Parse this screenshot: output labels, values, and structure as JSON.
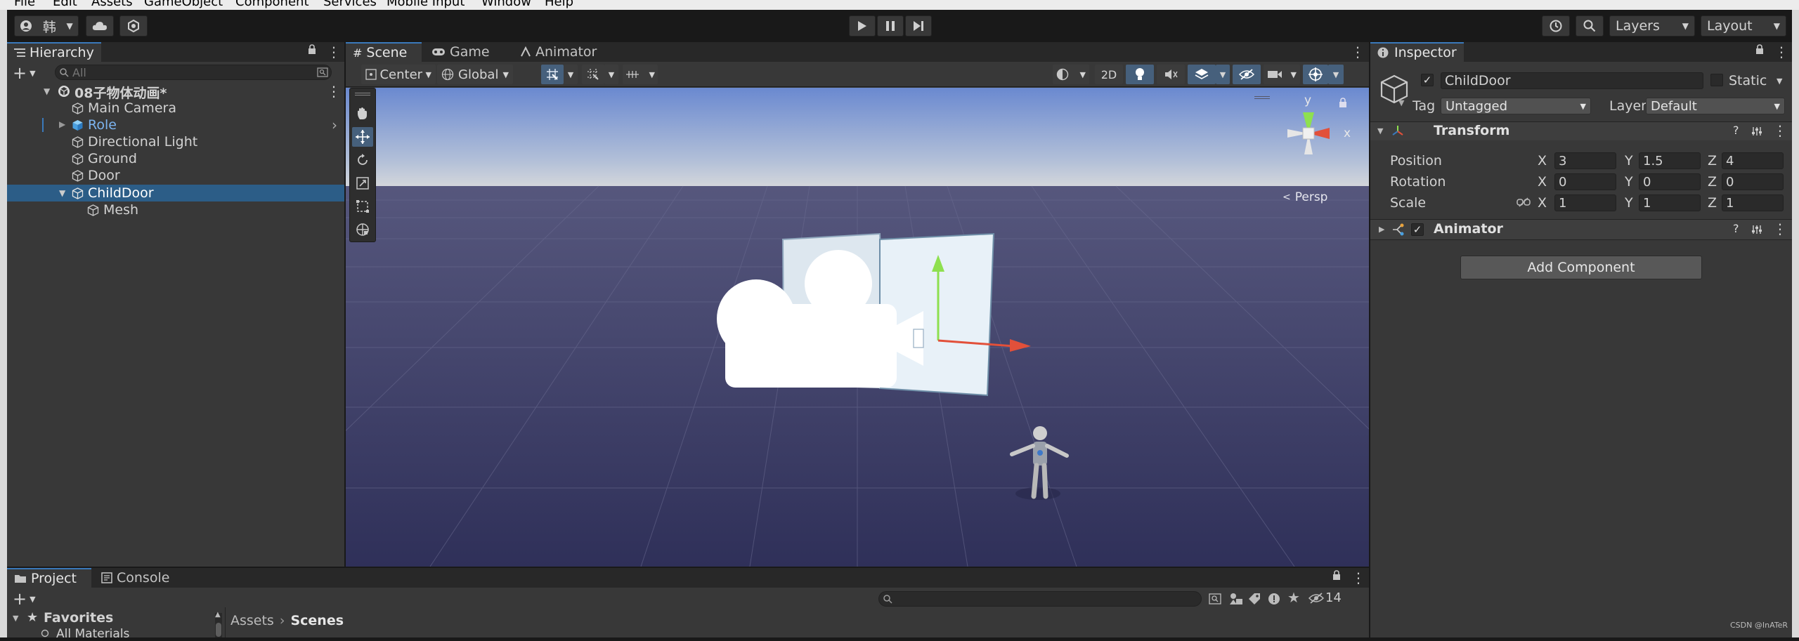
{
  "menu": [
    "File",
    "Edit",
    "Assets",
    "GameObject",
    "Component",
    "Services",
    "Mobile Input",
    "Window",
    "Help"
  ],
  "toolbar": {
    "account_label": "韩",
    "layers_label": "Layers",
    "layout_label": "Layout"
  },
  "hierarchy": {
    "tab_label": "Hierarchy",
    "search_placeholder": "All",
    "scene_name": "08子物体动画*",
    "items": [
      {
        "label": "Main Camera"
      },
      {
        "label": "Role"
      },
      {
        "label": "Directional Light"
      },
      {
        "label": "Ground"
      },
      {
        "label": "Door"
      },
      {
        "label": "ChildDoor"
      },
      {
        "label": "Mesh"
      }
    ]
  },
  "scene": {
    "tabs": [
      {
        "label": "Scene"
      },
      {
        "label": "Game"
      },
      {
        "label": "Animator"
      }
    ],
    "pivot_label": "Center",
    "space_label": "Global",
    "mode_2d_label": "2D",
    "gizmo_axis_y": "y",
    "gizmo_axis_x": "x",
    "projection_label": "Persp"
  },
  "inspector": {
    "tab_label": "Inspector",
    "object_name": "ChildDoor",
    "static_label": "Static",
    "tag_label": "Tag",
    "tag_value": "Untagged",
    "layer_label": "Layer",
    "layer_value": "Default",
    "transform": {
      "title": "Transform",
      "position_label": "Position",
      "rotation_label": "Rotation",
      "scale_label": "Scale",
      "axis_x": "X",
      "axis_y": "Y",
      "axis_z": "Z",
      "position": {
        "x": "3",
        "y": "1.5",
        "z": "4"
      },
      "rotation": {
        "x": "0",
        "y": "0",
        "z": "0"
      },
      "scale": {
        "x": "1",
        "y": "1",
        "z": "1"
      }
    },
    "animator_title": "Animator",
    "add_component_label": "Add Component"
  },
  "project": {
    "tabs": [
      {
        "label": "Project"
      },
      {
        "label": "Console"
      }
    ],
    "hidden_count": "14",
    "breadcrumb_root": "Assets",
    "breadcrumb_current": "Scenes",
    "favorites_label": "Favorites",
    "favorites_item": "All Materials"
  },
  "watermark": "CSDN @InATeR",
  "colors": {
    "selection": "#2c5d87",
    "accent": "#3a79bb",
    "sky_top": "#6f8fd6",
    "ground": "#3a3b66"
  }
}
